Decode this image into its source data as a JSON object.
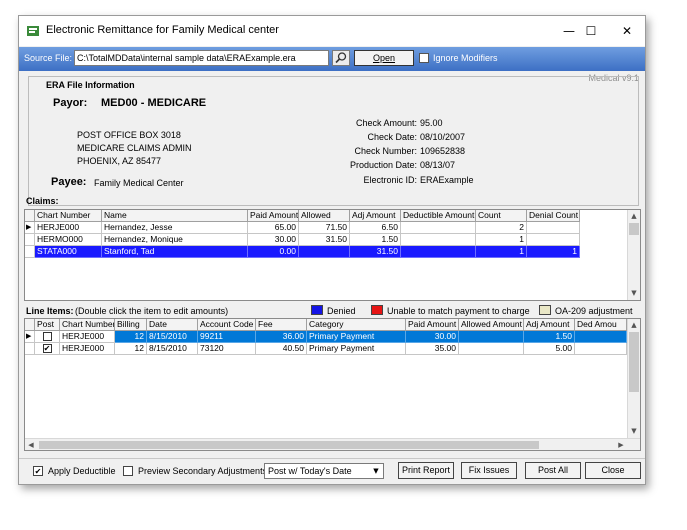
{
  "window": {
    "title": "Electronic Remittance for Family Medical center",
    "minimize": "—",
    "maximize": "☐",
    "close": "✕"
  },
  "source": {
    "label": "Source File:",
    "path": "C:\\TotalMDData\\internal sample data\\ERAExample.era",
    "open_label": "Open",
    "ignore_modifiers_label": "Ignore Modifiers"
  },
  "version": "Medical v9.1",
  "era_info": {
    "legend": "ERA File Information",
    "payor_label": "Payor:",
    "payor_value": "MED00 - MEDICARE",
    "address": [
      "POST OFFICE BOX 3018",
      "MEDICARE CLAIMS ADMIN",
      "PHOENIX, AZ  85477"
    ],
    "payee_label": "Payee:",
    "payee_value": "Family Medical Center",
    "fields": [
      {
        "label": "Check Amount:",
        "value": "95.00"
      },
      {
        "label": "Check Date:",
        "value": "08/10/2007"
      },
      {
        "label": "Check Number:",
        "value": "109652838"
      },
      {
        "label": "Production Date:",
        "value": "08/13/07"
      },
      {
        "label": "Electronic ID:",
        "value": "ERAExample"
      }
    ]
  },
  "claims": {
    "label": "Claims:",
    "columns": [
      "Chart Number",
      "Name",
      "Paid Amount",
      "Allowed",
      "Adj Amount",
      "Deductible Amount",
      "Count",
      "Denial Count"
    ],
    "rows": [
      {
        "chart": "HERJE000",
        "name": "Hernandez, Jesse",
        "paid": "65.00",
        "allowed": "71.50",
        "adj": "6.50",
        "deductible": "",
        "count": "2",
        "denial": ""
      },
      {
        "chart": "HERMO000",
        "name": "Hernandez, Monique",
        "paid": "30.00",
        "allowed": "31.50",
        "adj": "1.50",
        "deductible": "",
        "count": "1",
        "denial": ""
      },
      {
        "chart": "STATA000",
        "name": "Stanford, Tad",
        "paid": "0.00",
        "allowed": "",
        "adj": "31.50",
        "deductible": "",
        "count": "1",
        "denial": "1"
      }
    ]
  },
  "line_items": {
    "label": "Line Items:",
    "hint": "(Double click the item to edit amounts)",
    "legend": [
      {
        "label": "Denied",
        "color": "#1414e6"
      },
      {
        "label": "Unable to match payment to charge",
        "color": "#e61414"
      },
      {
        "label": "OA-209 adjustment",
        "color": "#e9e7c6"
      }
    ],
    "columns": [
      "Post",
      "Chart Number",
      "Billing",
      "Date",
      "Account Code",
      "Fee",
      "Category",
      "Paid Amount",
      "Allowed Amount",
      "Adj Amount",
      "Ded Amou"
    ],
    "rows": [
      {
        "post": "✔",
        "chart": "HERJE000",
        "billing": "12",
        "date": "8/15/2010",
        "code": "99211",
        "fee": "36.00",
        "category": "Primary Payment",
        "paid": "30.00",
        "allowed": "",
        "adj": "1.50",
        "ded": ""
      },
      {
        "post": "✔",
        "chart": "HERJE000",
        "billing": "12",
        "date": "8/15/2010",
        "code": "73120",
        "fee": "40.50",
        "category": "Primary Payment",
        "paid": "35.00",
        "allowed": "",
        "adj": "5.00",
        "ded": ""
      }
    ]
  },
  "footer": {
    "apply_deductible": "Apply Deductible",
    "apply_deductible_mark": "✔",
    "preview_secondary": "Preview Secondary Adjustments",
    "post_option": "Post w/ Today's Date",
    "print_report": "Print Report",
    "fix_issues": "Fix Issues",
    "post_all": "Post All",
    "close": "Close"
  },
  "glyphs": {
    "row_pointer": "▶",
    "up": "▲",
    "down": "▼",
    "left": "◀",
    "right": "▶",
    "dropdown": "▼"
  }
}
